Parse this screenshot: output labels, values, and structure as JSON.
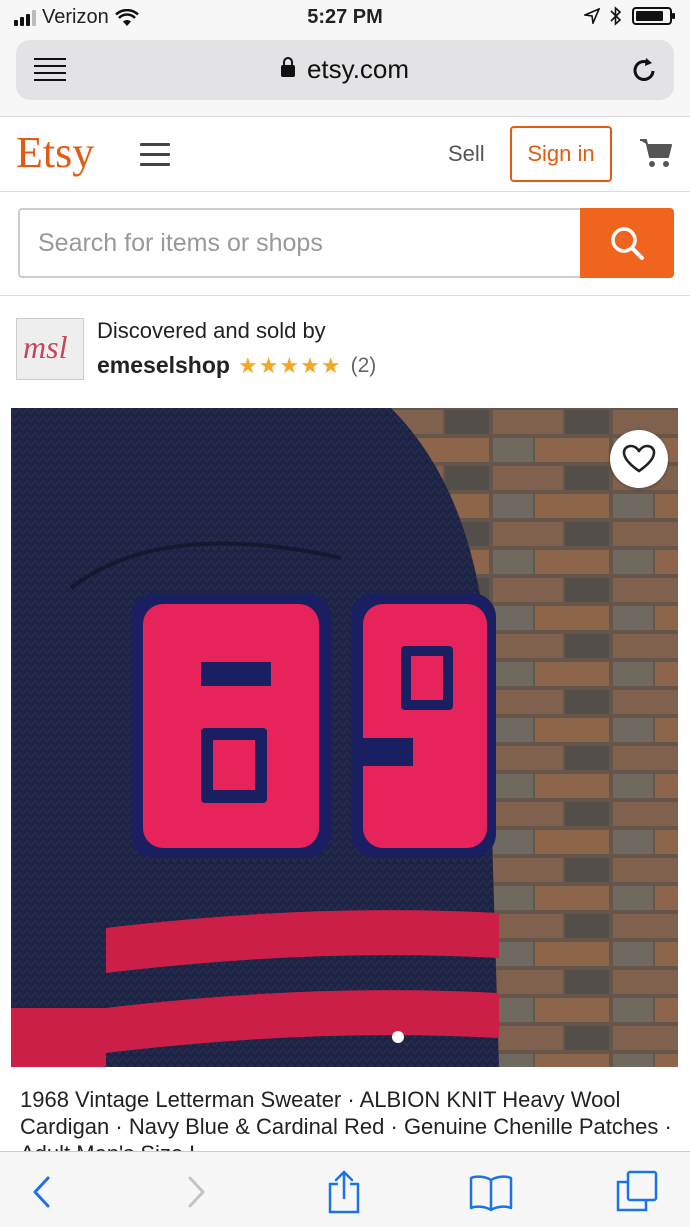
{
  "status_bar": {
    "carrier": "Verizon",
    "time": "5:27 PM",
    "signal_bars": 3,
    "signal_bars_total": 4
  },
  "browser": {
    "url": "etsy.com",
    "icons": [
      "reader-icon",
      "lock-icon",
      "reload-icon"
    ]
  },
  "header": {
    "logo": "Etsy",
    "sell_label": "Sell",
    "signin_label": "Sign in",
    "brand_color": "#e35b12",
    "icons": [
      "menu-icon",
      "cart-icon"
    ]
  },
  "search": {
    "placeholder": "Search for items or shops",
    "value": "",
    "button_color": "#f1641e"
  },
  "shop": {
    "discovered_label": "Discovered and sold by",
    "name": "emeselshop",
    "rating": 5,
    "rating_max": 5,
    "review_count": "(2)",
    "avatar_text": "msl"
  },
  "product": {
    "title": "1968 Vintage Letterman Sweater · ALBION KNIT Heavy Wool Cardigan · Navy Blue & Cardinal Red · Genuine Chenille Patches · Adult Men's Size L",
    "image_numerals": "69",
    "image_index": 1,
    "image_count": 1
  },
  "toolbar": {
    "items": [
      "back-icon",
      "forward-icon",
      "share-icon",
      "bookmarks-icon",
      "tabs-icon"
    ]
  }
}
